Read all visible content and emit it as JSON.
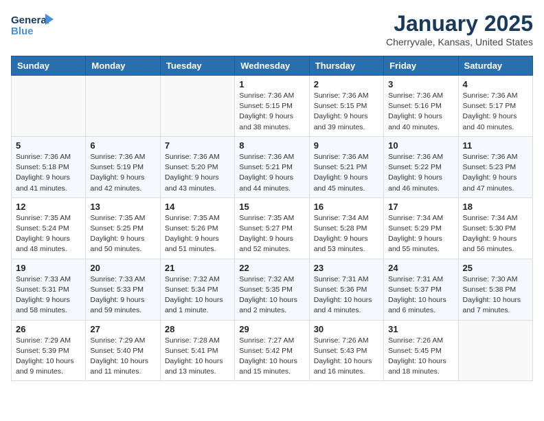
{
  "logo": {
    "line1": "General",
    "line2": "Blue"
  },
  "title": "January 2025",
  "location": "Cherryvale, Kansas, United States",
  "weekdays": [
    "Sunday",
    "Monday",
    "Tuesday",
    "Wednesday",
    "Thursday",
    "Friday",
    "Saturday"
  ],
  "weeks": [
    [
      {
        "day": "",
        "info": ""
      },
      {
        "day": "",
        "info": ""
      },
      {
        "day": "",
        "info": ""
      },
      {
        "day": "1",
        "info": "Sunrise: 7:36 AM\nSunset: 5:15 PM\nDaylight: 9 hours\nand 38 minutes."
      },
      {
        "day": "2",
        "info": "Sunrise: 7:36 AM\nSunset: 5:15 PM\nDaylight: 9 hours\nand 39 minutes."
      },
      {
        "day": "3",
        "info": "Sunrise: 7:36 AM\nSunset: 5:16 PM\nDaylight: 9 hours\nand 40 minutes."
      },
      {
        "day": "4",
        "info": "Sunrise: 7:36 AM\nSunset: 5:17 PM\nDaylight: 9 hours\nand 40 minutes."
      }
    ],
    [
      {
        "day": "5",
        "info": "Sunrise: 7:36 AM\nSunset: 5:18 PM\nDaylight: 9 hours\nand 41 minutes."
      },
      {
        "day": "6",
        "info": "Sunrise: 7:36 AM\nSunset: 5:19 PM\nDaylight: 9 hours\nand 42 minutes."
      },
      {
        "day": "7",
        "info": "Sunrise: 7:36 AM\nSunset: 5:20 PM\nDaylight: 9 hours\nand 43 minutes."
      },
      {
        "day": "8",
        "info": "Sunrise: 7:36 AM\nSunset: 5:21 PM\nDaylight: 9 hours\nand 44 minutes."
      },
      {
        "day": "9",
        "info": "Sunrise: 7:36 AM\nSunset: 5:21 PM\nDaylight: 9 hours\nand 45 minutes."
      },
      {
        "day": "10",
        "info": "Sunrise: 7:36 AM\nSunset: 5:22 PM\nDaylight: 9 hours\nand 46 minutes."
      },
      {
        "day": "11",
        "info": "Sunrise: 7:36 AM\nSunset: 5:23 PM\nDaylight: 9 hours\nand 47 minutes."
      }
    ],
    [
      {
        "day": "12",
        "info": "Sunrise: 7:35 AM\nSunset: 5:24 PM\nDaylight: 9 hours\nand 48 minutes."
      },
      {
        "day": "13",
        "info": "Sunrise: 7:35 AM\nSunset: 5:25 PM\nDaylight: 9 hours\nand 50 minutes."
      },
      {
        "day": "14",
        "info": "Sunrise: 7:35 AM\nSunset: 5:26 PM\nDaylight: 9 hours\nand 51 minutes."
      },
      {
        "day": "15",
        "info": "Sunrise: 7:35 AM\nSunset: 5:27 PM\nDaylight: 9 hours\nand 52 minutes."
      },
      {
        "day": "16",
        "info": "Sunrise: 7:34 AM\nSunset: 5:28 PM\nDaylight: 9 hours\nand 53 minutes."
      },
      {
        "day": "17",
        "info": "Sunrise: 7:34 AM\nSunset: 5:29 PM\nDaylight: 9 hours\nand 55 minutes."
      },
      {
        "day": "18",
        "info": "Sunrise: 7:34 AM\nSunset: 5:30 PM\nDaylight: 9 hours\nand 56 minutes."
      }
    ],
    [
      {
        "day": "19",
        "info": "Sunrise: 7:33 AM\nSunset: 5:31 PM\nDaylight: 9 hours\nand 58 minutes."
      },
      {
        "day": "20",
        "info": "Sunrise: 7:33 AM\nSunset: 5:33 PM\nDaylight: 9 hours\nand 59 minutes."
      },
      {
        "day": "21",
        "info": "Sunrise: 7:32 AM\nSunset: 5:34 PM\nDaylight: 10 hours\nand 1 minute."
      },
      {
        "day": "22",
        "info": "Sunrise: 7:32 AM\nSunset: 5:35 PM\nDaylight: 10 hours\nand 2 minutes."
      },
      {
        "day": "23",
        "info": "Sunrise: 7:31 AM\nSunset: 5:36 PM\nDaylight: 10 hours\nand 4 minutes."
      },
      {
        "day": "24",
        "info": "Sunrise: 7:31 AM\nSunset: 5:37 PM\nDaylight: 10 hours\nand 6 minutes."
      },
      {
        "day": "25",
        "info": "Sunrise: 7:30 AM\nSunset: 5:38 PM\nDaylight: 10 hours\nand 7 minutes."
      }
    ],
    [
      {
        "day": "26",
        "info": "Sunrise: 7:29 AM\nSunset: 5:39 PM\nDaylight: 10 hours\nand 9 minutes."
      },
      {
        "day": "27",
        "info": "Sunrise: 7:29 AM\nSunset: 5:40 PM\nDaylight: 10 hours\nand 11 minutes."
      },
      {
        "day": "28",
        "info": "Sunrise: 7:28 AM\nSunset: 5:41 PM\nDaylight: 10 hours\nand 13 minutes."
      },
      {
        "day": "29",
        "info": "Sunrise: 7:27 AM\nSunset: 5:42 PM\nDaylight: 10 hours\nand 15 minutes."
      },
      {
        "day": "30",
        "info": "Sunrise: 7:26 AM\nSunset: 5:43 PM\nDaylight: 10 hours\nand 16 minutes."
      },
      {
        "day": "31",
        "info": "Sunrise: 7:26 AM\nSunset: 5:45 PM\nDaylight: 10 hours\nand 18 minutes."
      },
      {
        "day": "",
        "info": ""
      }
    ]
  ]
}
